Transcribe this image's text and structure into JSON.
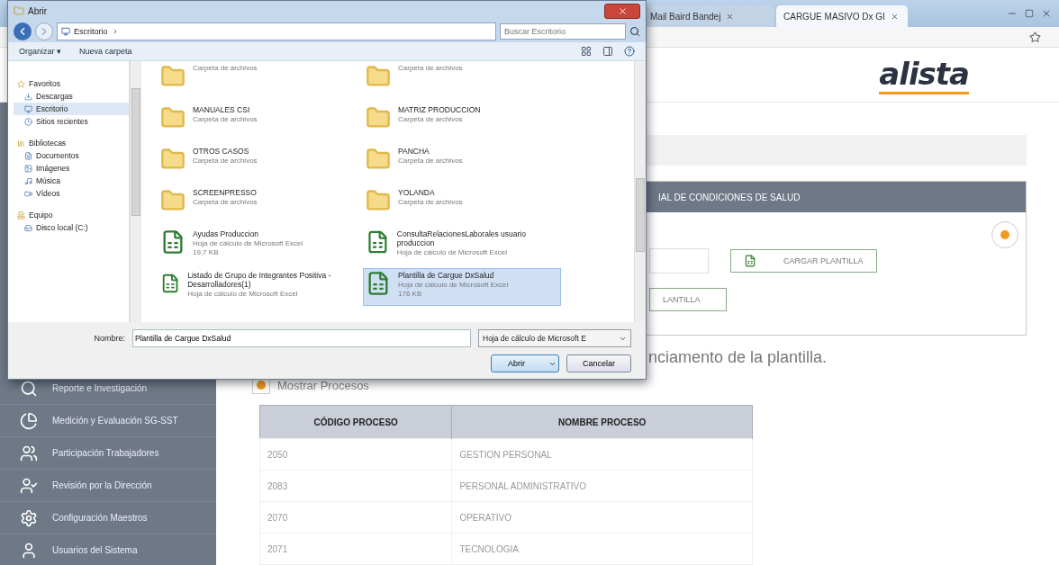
{
  "browser": {
    "tabs": [
      {
        "label": "Mail Baird Bandej",
        "selected": false
      },
      {
        "label": "CARGUE MASIVO Dx GI",
        "selected": true
      }
    ]
  },
  "header": {
    "logo": "alista"
  },
  "panel": {
    "title": "IAL DE CONDICIONES DE SALUD",
    "upload_button": "CARGAR PLANTILLA",
    "second_button": "LANTILLA"
  },
  "notice": "nciamento de la plantilla.",
  "toggle": {
    "label": "Mostrar Procesos",
    "on": true
  },
  "table": {
    "columns": [
      "CÓDIGO PROCESO",
      "NOMBRE PROCESO"
    ],
    "rows": [
      [
        "2050",
        "GESTION PERSONAL"
      ],
      [
        "2083",
        "PERSONAL ADMINISTRATIVO"
      ],
      [
        "2070",
        "OPERATIVO"
      ],
      [
        "2071",
        "TECNOLOGIA"
      ]
    ]
  },
  "sidebar": {
    "items": [
      {
        "label": "Reporte e Investigación"
      },
      {
        "label": "Medición y Evaluación SG-SST"
      },
      {
        "label": "Participación Trabajadores"
      },
      {
        "label": "Revisión por la Dirección"
      },
      {
        "label": "Configuración Maestros"
      },
      {
        "label": "Usuarios del Sistema"
      }
    ]
  },
  "dialog": {
    "title": "Abrir",
    "location": "Escritorio",
    "search": {
      "placeholder": "Buscar Escritorio"
    },
    "toolbar": [
      "Organizar ▾",
      "Nueva carpeta"
    ],
    "nav": [
      {
        "kind": "group",
        "label": "Favoritos",
        "selected": false
      },
      {
        "kind": "item",
        "label": "Descargas",
        "selected": false
      },
      {
        "kind": "item",
        "label": "Escritorio",
        "selected": true
      },
      {
        "kind": "item",
        "label": "Sitios recientes",
        "selected": false
      },
      {
        "kind": "group",
        "label": "Bibliotecas",
        "selected": false
      },
      {
        "kind": "item",
        "label": "Documentos",
        "selected": false
      },
      {
        "kind": "item",
        "label": "Imágenes",
        "selected": false
      },
      {
        "kind": "item",
        "label": "Música",
        "selected": false
      },
      {
        "kind": "item",
        "label": "Vídeos",
        "selected": false
      },
      {
        "kind": "group",
        "label": "Equipo",
        "selected": false
      },
      {
        "kind": "item",
        "label": "Disco local (C:)",
        "selected": false
      }
    ],
    "files": [
      {
        "kind": "folder",
        "lines": [
          "Carpeta de archivos"
        ],
        "selected": false
      },
      {
        "kind": "folder",
        "lines": [
          "Carpeta de archivos"
        ],
        "selected": false
      },
      {
        "kind": "folder",
        "name": "MANUALES CSI",
        "lines": [
          "Carpeta de archivos"
        ],
        "selected": false
      },
      {
        "kind": "folder",
        "name": "MATRIZ PRODUCCION",
        "lines": [
          "Carpeta de archivos"
        ],
        "selected": false
      },
      {
        "kind": "folder",
        "name": "OTROS CASOS",
        "lines": [
          "Carpeta de archivos"
        ],
        "selected": false
      },
      {
        "kind": "folder",
        "name": "PANCHA",
        "lines": [
          "Carpeta de archivos"
        ],
        "selected": false
      },
      {
        "kind": "folder",
        "name": "SCREENPRESSO",
        "lines": [
          "Carpeta de archivos"
        ],
        "selected": false
      },
      {
        "kind": "folder",
        "name": "YOLANDA",
        "lines": [
          "Carpeta de archivos"
        ],
        "selected": false
      },
      {
        "kind": "excel",
        "name": "Ayudas Produccion",
        "lines": [
          "Hoja de cálculo de Microsoft Excel",
          "19,7 KB"
        ],
        "selected": false
      },
      {
        "kind": "excel",
        "name": "ConsultaRelacionesLaborales usuario produccion",
        "lines": [
          "Hoja de cálculo de Microsoft Excel"
        ],
        "selected": false
      },
      {
        "kind": "excel",
        "name": "Listado de Grupo de Integrantes Positiva - Desarrolladores(1)",
        "lines": [
          "Hoja de cálculo de Microsoft Excel"
        ],
        "selected": false
      },
      {
        "kind": "excel",
        "name": "Plantilla de Cargue DxSalud",
        "lines": [
          "Hoja de cálculo de Microsoft Excel",
          "176 KB"
        ],
        "selected": true
      }
    ],
    "filename_label": "Nombre:",
    "filename": "Plantilla de Cargue DxSalud",
    "filter": "Hoja de cálculo de Microsoft E",
    "open_button": "Abrir",
    "cancel_button": "Cancelar"
  }
}
